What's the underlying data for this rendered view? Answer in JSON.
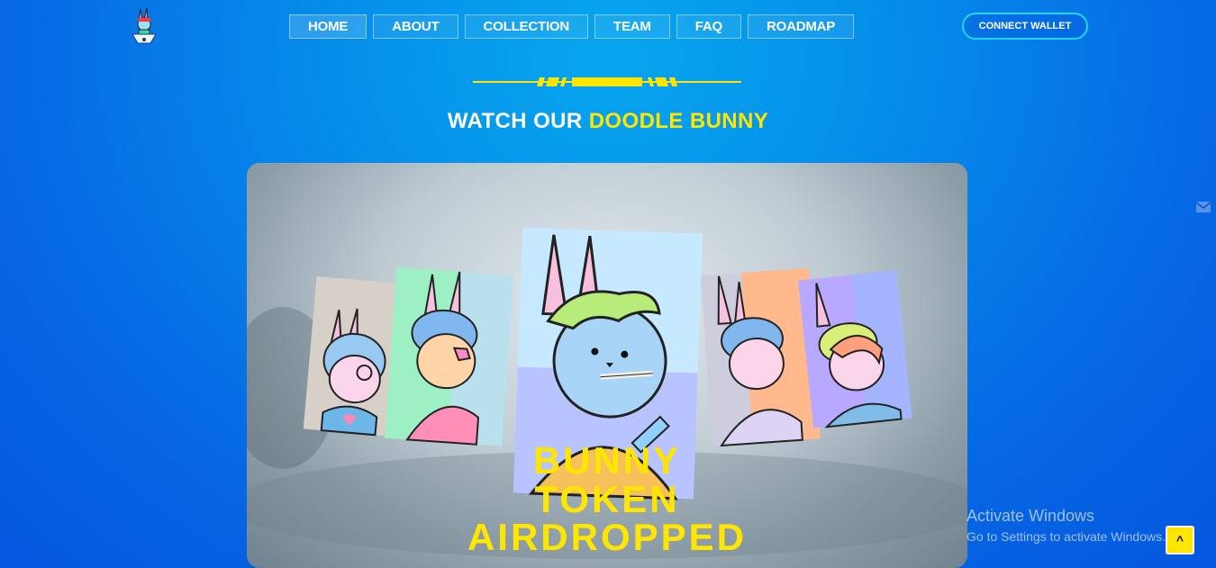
{
  "nav": {
    "items": [
      {
        "label": "HOME"
      },
      {
        "label": "ABOUT"
      },
      {
        "label": "COLLECTION"
      },
      {
        "label": "TEAM"
      },
      {
        "label": "FAQ"
      },
      {
        "label": "ROADMAP"
      }
    ],
    "connect_wallet": "CONNECT WALLET"
  },
  "section": {
    "title_prefix": "WATCH OUR",
    "title_highlight": "DOODLE BUNNY"
  },
  "video": {
    "caption_line1": "BUNNY",
    "caption_line2": "TOKEN",
    "caption_line3": "AIRDROPPED"
  },
  "overlay": {
    "activate_title": "Activate Windows",
    "activate_subtitle": "Go to Settings to activate Windows."
  },
  "scroll_top": {
    "icon": "chevron-up-icon",
    "glyph": "^"
  },
  "colors": {
    "accent": "#ffe600",
    "wallet_border": "#21d6f2",
    "background": "#0668e4"
  }
}
